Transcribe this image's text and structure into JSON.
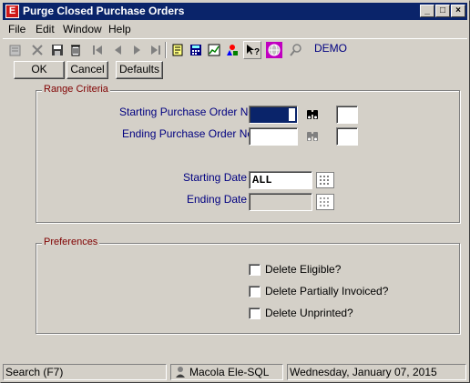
{
  "window": {
    "title": "Purge Closed Purchase Orders",
    "app_icon_letter": "E",
    "controls": {
      "minimize": "_",
      "maximize": "□",
      "close": "×"
    }
  },
  "menu": [
    "File",
    "Edit",
    "Window",
    "Help"
  ],
  "toolbar": {
    "company_label": "DEMO"
  },
  "buttons": {
    "ok": "OK",
    "cancel": "Cancel",
    "defaults": "Defaults"
  },
  "range_criteria": {
    "title": "Range Criteria",
    "start_po_label": "Starting Purchase Order No.",
    "start_po_value": "",
    "end_po_label": "Ending Purchase Order No.",
    "end_po_value": "",
    "start_date_label": "Starting Date",
    "start_date_value": "ALL",
    "end_date_label": "Ending Date",
    "end_date_value": ""
  },
  "preferences": {
    "title": "Preferences",
    "options": [
      {
        "label": "Delete Eligible?",
        "checked": false
      },
      {
        "label": "Delete Partially Invoiced?",
        "checked": false
      },
      {
        "label": "Delete Unprinted?",
        "checked": false
      }
    ]
  },
  "statusbar": {
    "hint": "Search (F7)",
    "user": "Macola Ele-SQL",
    "date": "Wednesday, January 07, 2015"
  },
  "colors": {
    "title_bar": "#0a246a",
    "group_title": "#800000",
    "label_blue": "#000080",
    "face": "#d4d0c8"
  }
}
